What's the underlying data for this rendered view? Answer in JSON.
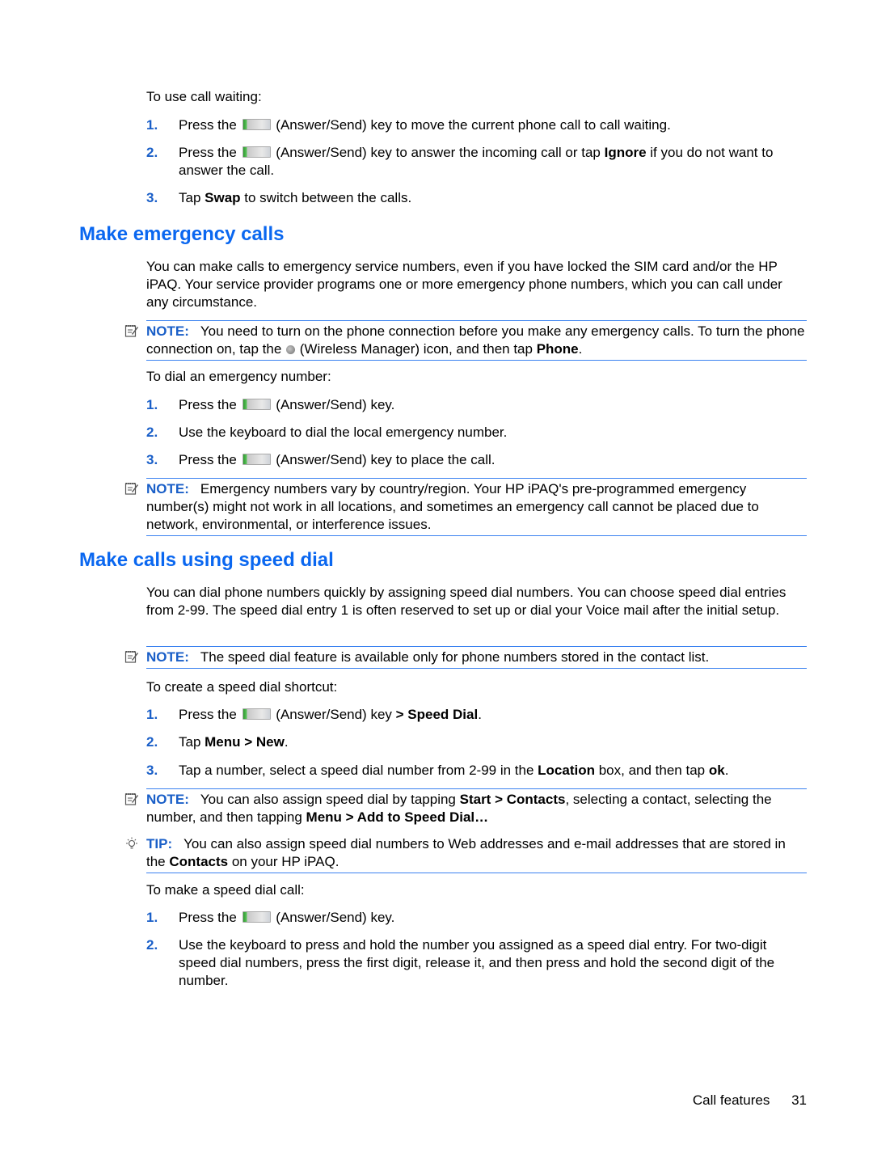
{
  "call_waiting": {
    "intro": "To use call waiting:",
    "steps": [
      {
        "num": "1.",
        "pre": "Press the",
        "key": "Answer/Send key icon",
        "post": "(Answer/Send) key to move the current phone call to call waiting."
      },
      {
        "num": "2.",
        "pre": "Press the",
        "post_a": "(Answer/Send) key to answer the incoming call or tap ",
        "bold": "Ignore",
        "post_b": " if you do not want to answer the call."
      },
      {
        "num": "3.",
        "pre": "Tap ",
        "bold": "Swap",
        "post": " to switch between the calls."
      }
    ]
  },
  "emergency": {
    "heading": "Make emergency calls",
    "body": "You can make calls to emergency service numbers, even if you have locked the SIM card and/or the HP iPAQ. Your service provider programs one or more emergency phone numbers, which you can call under any circumstance.",
    "note1": {
      "label": "NOTE:",
      "text_a": "You need to turn on the phone connection before you make any emergency calls. To turn the phone connection on, tap the",
      "text_b": "(Wireless Manager) icon, and then tap ",
      "bold": "Phone",
      "text_c": "."
    },
    "intro": "To dial an emergency number:",
    "steps": [
      {
        "num": "1.",
        "pre": "Press the",
        "post": "(Answer/Send) key."
      },
      {
        "num": "2.",
        "text": "Use the keyboard to dial the local emergency number."
      },
      {
        "num": "3.",
        "pre": "Press the",
        "post": "(Answer/Send) key to place the call."
      }
    ],
    "note2": {
      "label": "NOTE:",
      "text": "Emergency numbers vary by country/region. Your HP iPAQ's pre-programmed emergency number(s) might not work in all locations, and sometimes an emergency call cannot be placed due to network, environmental, or interference issues."
    }
  },
  "speed_dial": {
    "heading": "Make calls using speed dial",
    "body": "You can dial phone numbers quickly by assigning speed dial numbers. You can choose speed dial entries from 2-99. The speed dial entry 1 is often reserved to set up or dial your Voice mail after the initial setup.",
    "note1": {
      "label": "NOTE:",
      "text": "The speed dial feature is available only for phone numbers stored in the contact list."
    },
    "intro_create": "To create a speed dial shortcut:",
    "create_steps": [
      {
        "num": "1.",
        "pre": "Press the",
        "post": "(Answer/Send) key ",
        "bold": "> Speed Dial",
        "end": "."
      },
      {
        "num": "2.",
        "pre": "Tap ",
        "bold": "Menu > New",
        "end": "."
      },
      {
        "num": "3.",
        "pre": "Tap a number, select a speed dial number from 2-99 in the ",
        "bold": "Location",
        "mid": " box, and then tap ",
        "bold2": "ok",
        "end": "."
      }
    ],
    "note2": {
      "label": "NOTE:",
      "text_a": "You can also assign speed dial by tapping ",
      "bold_a": "Start > Contacts",
      "text_b": ", selecting a contact, selecting the number, and then tapping ",
      "bold_b": "Menu > Add to Speed Dial…"
    },
    "tip": {
      "label": "TIP:",
      "text_a": "You can also assign speed dial numbers to Web addresses and e-mail addresses that are stored in the ",
      "bold": "Contacts",
      "text_b": " on your HP iPAQ."
    },
    "intro_call": "To make a speed dial call:",
    "call_steps": [
      {
        "num": "1.",
        "pre": "Press the",
        "post": "(Answer/Send) key."
      },
      {
        "num": "2.",
        "text": "Use the keyboard to press and hold the number you assigned as a speed dial entry. For two-digit speed dial numbers, press the first digit, release it, and then press and hold the second digit of the number."
      }
    ]
  },
  "footer": {
    "section": "Call features",
    "page": "31"
  }
}
